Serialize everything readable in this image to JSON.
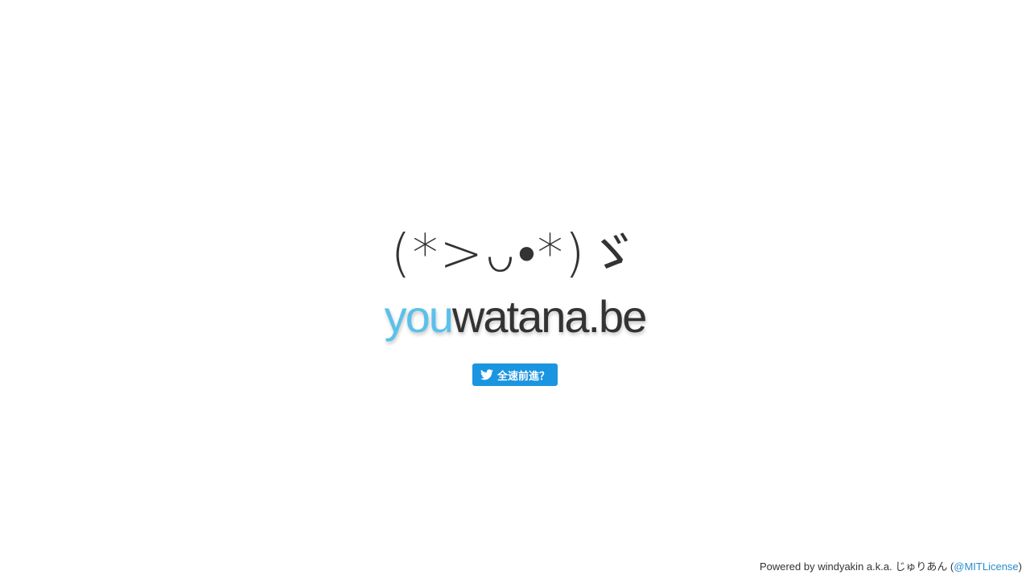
{
  "kaomoji": "(*>ᴗ•*)ゞ",
  "logo": {
    "highlight": "you",
    "rest": "watana.be",
    "highlight_color": "#5bc0eb",
    "rest_color": "#333333"
  },
  "tweet_button": {
    "icon": "twitter-bird-icon",
    "label": "全速前進？",
    "color": "#1b95e0"
  },
  "footer": {
    "prefix": "Powered by windyakin a.k.a. じゅりあん (",
    "link_label": "@MITLicense",
    "suffix": ")",
    "link_color": "#2b8ccf"
  }
}
